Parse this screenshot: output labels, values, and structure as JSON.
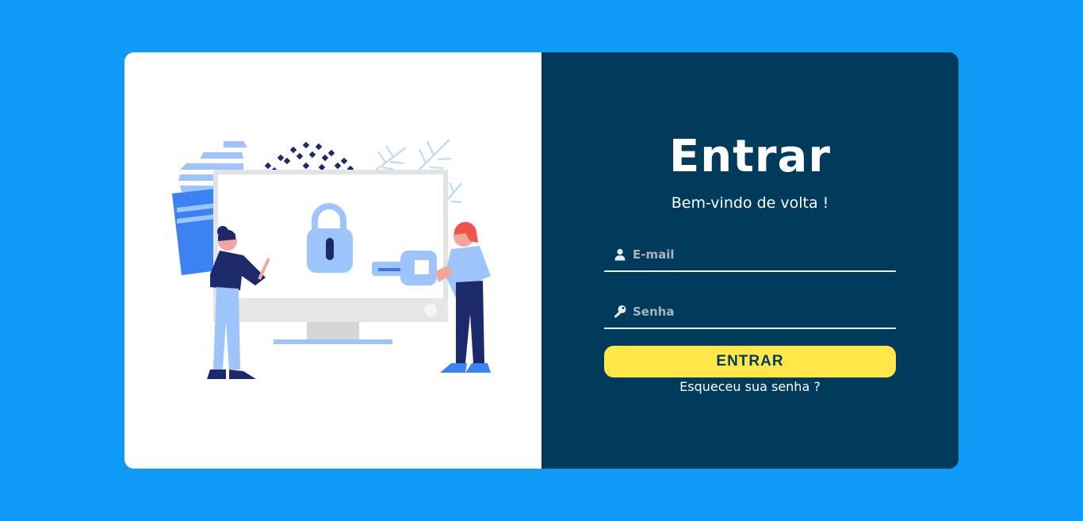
{
  "login": {
    "title": "Entrar",
    "subtitle": "Bem-vindo de volta !",
    "email_placeholder": "E-mail",
    "password_placeholder": "Senha",
    "submit_label": "ENTRAR",
    "forgot_label": "Esqueceu sua senha ?"
  },
  "icons": {
    "email_field_icon": "user-icon",
    "password_field_icon": "key-icon",
    "illustration": "security-login-illustration"
  },
  "colors": {
    "page_background": "#0f9af7",
    "panel_background": "#003b5c",
    "button_background": "#ffe748",
    "button_text": "#003b5c"
  }
}
